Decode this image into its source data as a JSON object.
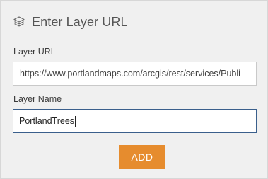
{
  "header": {
    "icon": "layers-icon",
    "title": "Enter Layer URL"
  },
  "layer_url": {
    "label": "Layer URL",
    "value": "https://www.portlandmaps.com/arcgis/rest/services/Publi"
  },
  "layer_name": {
    "label": "Layer Name",
    "value": "PortlandTrees"
  },
  "add_button": {
    "label": "ADD",
    "color": "#e68c2e"
  },
  "colors": {
    "panel_background": "#f0f0f0",
    "focused_field_border": "#3a5f8c"
  }
}
